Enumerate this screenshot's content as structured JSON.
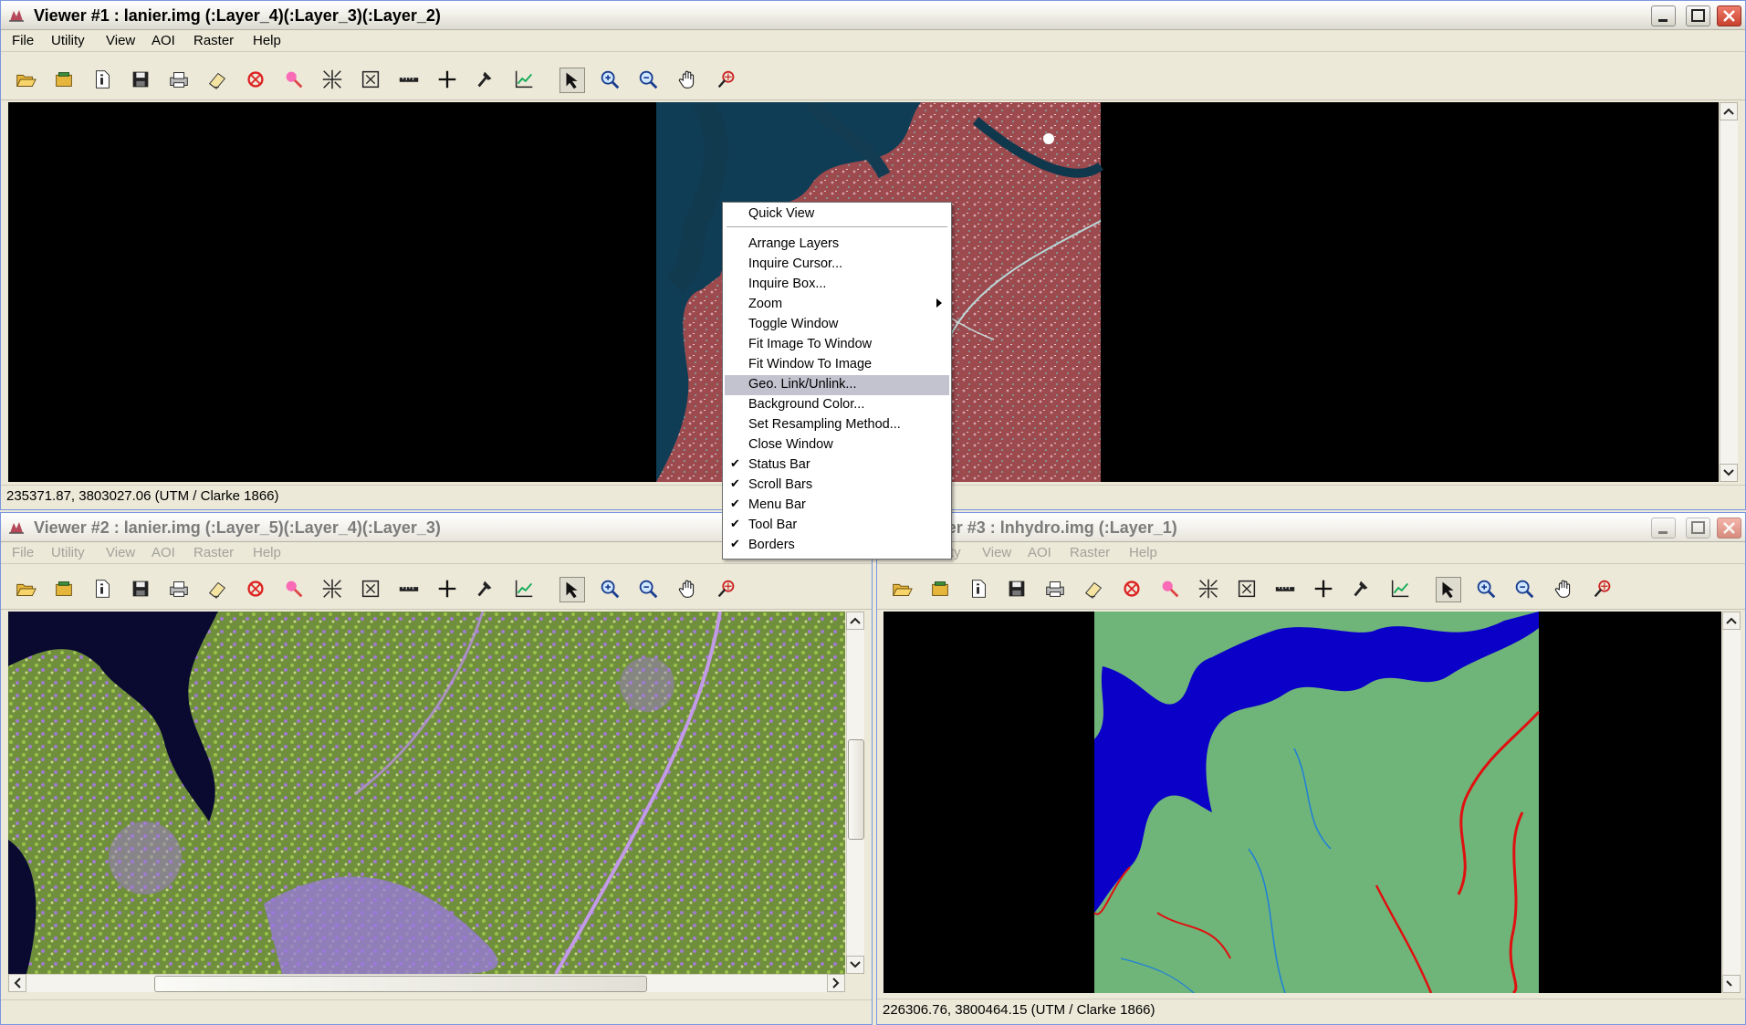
{
  "menus": [
    "File",
    "Utility",
    "View",
    "AOI",
    "Raster",
    "Help"
  ],
  "toolbar": [
    "open-folder-icon",
    "new-layer-icon",
    "info-icon",
    "save-icon",
    "print-icon",
    "eraser-icon",
    "clear-icon",
    "measure-icon",
    "fit-in-icon",
    "fit-out-icon",
    "ruler-icon",
    "crosshair-icon",
    "pick-icon",
    "profile-icon",
    "select-arrow-icon",
    "zoom-in-icon",
    "zoom-out-icon",
    "pan-hand-icon",
    "inquire-icon"
  ],
  "viewer1": {
    "title": "Viewer #1 : lanier.img (:Layer_4)(:Layer_3)(:Layer_2)",
    "status": "235371.87, 3803027.06   (UTM / Clarke 1866)"
  },
  "viewer2": {
    "title": "Viewer #2 : lanier.img (:Layer_5)(:Layer_4)(:Layer_3)"
  },
  "viewer3": {
    "title": "Viewer #3 : lnhydro.img (:Layer_1)",
    "status": "226306.76, 3800464.15   (UTM / Clarke 1866)"
  },
  "context_menu": {
    "items": [
      {
        "label": "Quick View"
      },
      {
        "label": "Arrange Layers"
      },
      {
        "label": "Inquire Cursor..."
      },
      {
        "label": "Inquire Box..."
      },
      {
        "label": "Zoom",
        "submenu": true
      },
      {
        "label": "Toggle Window"
      },
      {
        "label": "Fit Image To Window"
      },
      {
        "label": "Fit Window To Image"
      },
      {
        "label": "Geo. Link/Unlink...",
        "highlighted": true
      },
      {
        "label": "Background Color..."
      },
      {
        "label": "Set Resampling Method..."
      },
      {
        "label": "Close Window"
      },
      {
        "label": "Status Bar",
        "checked": true
      },
      {
        "label": "Scroll Bars",
        "checked": true
      },
      {
        "label": "Menu Bar",
        "checked": true
      },
      {
        "label": "Tool Bar",
        "checked": true
      },
      {
        "label": "Borders",
        "checked": true
      }
    ]
  },
  "colors": {
    "water": "#0a00c8",
    "land": "#6fb57a",
    "stream_red": "#e01010",
    "stream_blue": "#1e7fd8",
    "menu_highlight": "#c3c2cf"
  }
}
